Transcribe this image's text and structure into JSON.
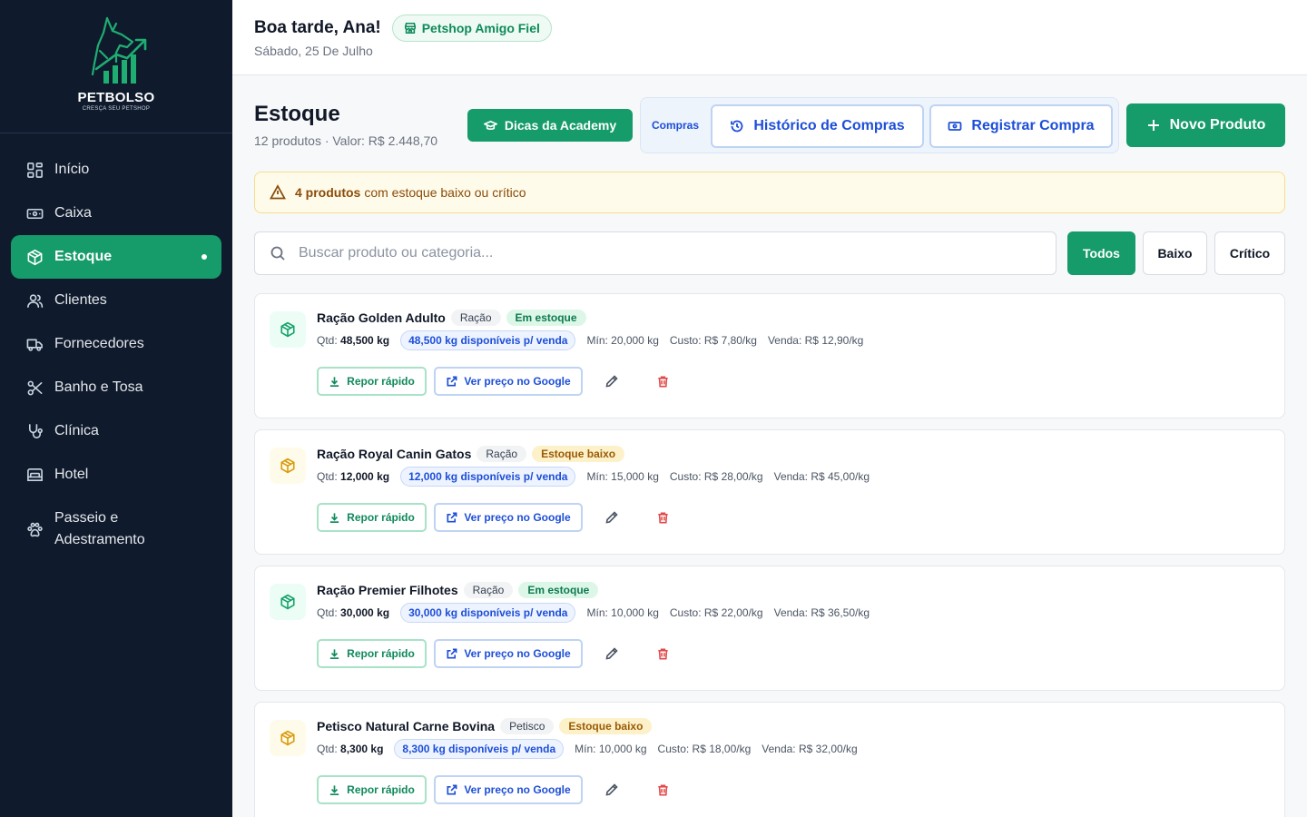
{
  "sidebar": {
    "brand": "PETBOLSO",
    "tagline": "CRESÇA SEU PETSHOP",
    "items": [
      {
        "label": "Início",
        "icon": "grid-icon"
      },
      {
        "label": "Caixa",
        "icon": "cash-icon"
      },
      {
        "label": "Estoque",
        "icon": "box-icon",
        "active": true
      },
      {
        "label": "Clientes",
        "icon": "users-icon"
      },
      {
        "label": "Fornecedores",
        "icon": "truck-icon"
      },
      {
        "label": "Banho e Tosa",
        "icon": "scissors-icon"
      },
      {
        "label": "Clínica",
        "icon": "stethoscope-icon"
      },
      {
        "label": "Hotel",
        "icon": "bed-icon"
      },
      {
        "label": "Passeio e Adestramento",
        "icon": "paw-icon"
      }
    ]
  },
  "header": {
    "greeting": "Boa tarde, Ana!",
    "shop_name": "Petshop Amigo Fiel",
    "date": "Sábado, 25 De Julho"
  },
  "page": {
    "title": "Estoque",
    "subtitle": "12 produtos · Valor: R$ 2.448,70",
    "academy_button": "Dicas da Academy",
    "compras_label": "Compras",
    "history_button": "Histórico de Compras",
    "register_button": "Registrar Compra",
    "new_button": "Novo Produto"
  },
  "alert": {
    "count_text": "4 produtos",
    "message": "com estoque baixo ou crítico"
  },
  "search": {
    "placeholder": "Buscar produto ou categoria..."
  },
  "filters": {
    "all": "Todos",
    "low": "Baixo",
    "critical": "Crítico",
    "selected": "Todos"
  },
  "labels": {
    "qty_prefix": "Qtd:",
    "restock": "Repor rápido",
    "google": "Ver preço no Google"
  },
  "colors": {
    "sidebar_bg": "#0f1b2d",
    "accent": "#169b6a",
    "blue": "#1d4ed8",
    "warning_bg": "#fffbea",
    "danger": "#e24848"
  },
  "products": [
    {
      "name": "Ração Golden Adulto",
      "category": "Ração",
      "status": "Em estoque",
      "status_type": "ok",
      "qty": "48,500 kg",
      "available": "48,500 kg disponíveis p/ venda",
      "min": "Mín: 20,000 kg",
      "cost": "Custo: R$ 7,80/kg",
      "price": "Venda: R$ 12,90/kg"
    },
    {
      "name": "Ração Royal Canin Gatos",
      "category": "Ração",
      "status": "Estoque baixo",
      "status_type": "low",
      "qty": "12,000 kg",
      "available": "12,000 kg disponíveis p/ venda",
      "min": "Mín: 15,000 kg",
      "cost": "Custo: R$ 28,00/kg",
      "price": "Venda: R$ 45,00/kg"
    },
    {
      "name": "Ração Premier Filhotes",
      "category": "Ração",
      "status": "Em estoque",
      "status_type": "ok",
      "qty": "30,000 kg",
      "available": "30,000 kg disponíveis p/ venda",
      "min": "Mín: 10,000 kg",
      "cost": "Custo: R$ 22,00/kg",
      "price": "Venda: R$ 36,50/kg"
    },
    {
      "name": "Petisco Natural Carne Bovina",
      "category": "Petisco",
      "status": "Estoque baixo",
      "status_type": "low",
      "qty": "8,300 kg",
      "available": "8,300 kg disponíveis p/ venda",
      "min": "Mín: 10,000 kg",
      "cost": "Custo: R$ 18,00/kg",
      "price": "Venda: R$ 32,00/kg"
    }
  ]
}
